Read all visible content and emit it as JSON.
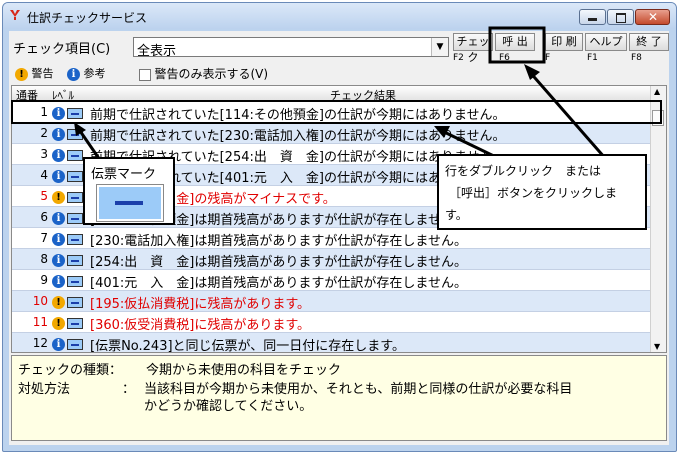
{
  "window": {
    "title": "仕訳チェックサービス"
  },
  "toolbar": {
    "check_item_label": "チェック項目(C)",
    "check_item_value": "全表示",
    "buttons": [
      {
        "label": "チェック",
        "fkey": "F2"
      },
      {
        "label": "呼 出",
        "fkey": "F6"
      },
      {
        "label": "印 刷",
        "fkey": "F"
      },
      {
        "label": "ヘルプ",
        "fkey": "F1"
      },
      {
        "label": "終 了",
        "fkey": "F8"
      }
    ]
  },
  "legend": {
    "warning": "警告",
    "reference": "参考",
    "warnings_only": "警告のみ表示する(V)"
  },
  "grid": {
    "headers": {
      "number": "通番",
      "level": "ﾚﾍﾞﾙ",
      "result": "チェック結果"
    },
    "rows": [
      {
        "no": "1",
        "level": "info",
        "text": "前期で仕訳されていた[114:その他預金]の仕訳が今期にはありません。",
        "red": false
      },
      {
        "no": "2",
        "level": "info",
        "text": "前期で仕訳されていた[230:電話加入権]の仕訳が今期にはありません。",
        "red": false
      },
      {
        "no": "3",
        "level": "info",
        "text": "前期で仕訳されていた[254:出　資　金]の仕訳が今期にはありません。",
        "red": false
      },
      {
        "no": "4",
        "level": "info",
        "text": "前期で仕訳されていた[401:元　入　金]の仕訳が今期にはありません。",
        "red": false
      },
      {
        "no": "5",
        "level": "warning",
        "text": "[254:出　資　金]の残高がマイナスです。",
        "red": true
      },
      {
        "no": "6",
        "level": "info",
        "text": "[114:その他預金]は期首残高がありますが仕訳が存在しません。",
        "red": false
      },
      {
        "no": "7",
        "level": "info",
        "text": "[230:電話加入権]は期首残高がありますが仕訳が存在しません。",
        "red": false
      },
      {
        "no": "8",
        "level": "info",
        "text": "[254:出　資　金]は期首残高がありますが仕訳が存在しません。",
        "red": false
      },
      {
        "no": "9",
        "level": "info",
        "text": "[401:元　入　金]は期首残高がありますが仕訳が存在しません。",
        "red": false
      },
      {
        "no": "10",
        "level": "warning",
        "text": "[195:仮払消費税]に残高があります。",
        "red": true
      },
      {
        "no": "11",
        "level": "warning",
        "text": "[360:仮受消費税]に残高があります。",
        "red": true
      },
      {
        "no": "12",
        "level": "info",
        "text": "[伝票No.243]と同じ伝票が、同一日付に存在します。",
        "red": false
      }
    ]
  },
  "details": {
    "type_label": "チェックの種類：",
    "type_value": "今期から未使用の科目をチェック",
    "action_label": "対処方法",
    "action_sep": "：",
    "action_value_1": "当該科目が今期から未使用か、それとも、前期と同様の仕訳が必要な科目",
    "action_value_2": "かどうか確認してください。"
  },
  "annotations": {
    "slip_mark": "伝票マーク",
    "double_click_1": "行をダブルクリック　または",
    "double_click_2": "［呼出］ボタンをクリックしま",
    "double_click_3": "す。"
  }
}
